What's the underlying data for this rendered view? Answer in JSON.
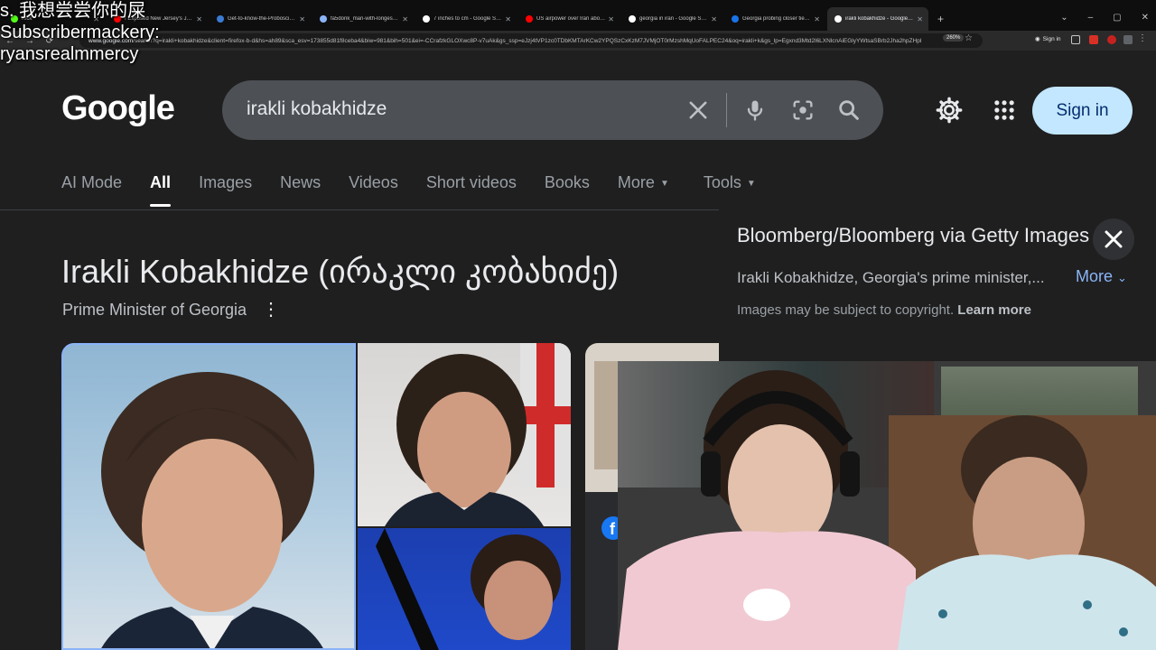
{
  "overlay": {
    "line1": "s. 我想尝尝你的屎",
    "line2": "Subscribermackery:",
    "line3": "ryansrealmmercy"
  },
  "browser": {
    "tabs": [
      {
        "title": "Kick",
        "fav": "#53fc18"
      },
      {
        "title": "I Exposed New Jersey's Jewish",
        "fav": "#ff0000"
      },
      {
        "title": "Get-to-know-the-Proboscis-Mo",
        "fav": "#3a7bd5"
      },
      {
        "title": "fa5donk_man-with-longest-nose-g",
        "fav": "#8ab4f8"
      },
      {
        "title": "7 inches to cm - Google Search",
        "fav": "#ffffff"
      },
      {
        "title": "US airpower over Iran about to",
        "fav": "#ff0000"
      },
      {
        "title": "georgia in iran - Google Search",
        "fav": "#ffffff"
      },
      {
        "title": "Georgia probing closer ties with",
        "fav": "#1a73e8"
      },
      {
        "title": "irakli kobakhidze - Google Search",
        "fav": "#ffffff"
      }
    ],
    "url_host": "www.google.com",
    "url_rest": "/search?q=irakli+kobakhidze&client=firefox-b-d&hs=ah89&sca_esv=173855d81f8ceba4&biw=981&bih=501&ei=-CCrafzkGLOXwc8P-v7uAk&gs_ssp=eJzj4tVP1zc0TDbKMTArKCw2YPQSzCxKzM7JVMjOT0rMzshMqUoFALPEC24&oq=irakli+k&gs_lp=Egxnd3Mtd2l6LXNlcnAiEGlyYWtsaSBrb2Jha2hpZHpl",
    "zoom": "260%",
    "signin": "Sign in"
  },
  "google": {
    "logo": "Google",
    "query": "irakli kobakhidze",
    "signin_label": "Sign in",
    "tabs": [
      "AI Mode",
      "All",
      "Images",
      "News",
      "Videos",
      "Short videos",
      "Books",
      "More",
      "Tools"
    ],
    "active_tab": "All"
  },
  "knowledge_panel": {
    "title": "Irakli Kobakhidze (ირაკლი კობახიძე)",
    "subtitle": "Prime Minister of Georgia"
  },
  "viewer": {
    "source": "Bloomberg/Bloomberg via Getty Images",
    "caption": "Irakli Kobakhidze, Georgia's prime minister,...",
    "more_label": "More",
    "copyright": "Images may be subject to copyright.",
    "learn_more": "Learn more"
  },
  "colors": {
    "accent_blue": "#8ab4f8",
    "signin_bg": "#c2e7ff",
    "page_bg": "#1f1f1f"
  }
}
